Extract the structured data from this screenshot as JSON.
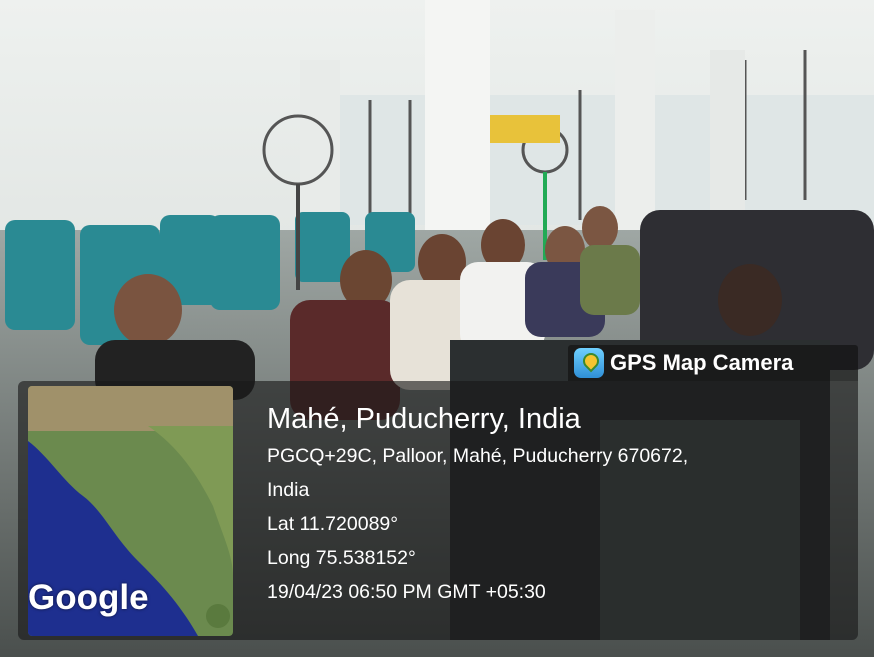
{
  "overlay": {
    "app_name": "GPS Map Camera",
    "location_title": "Mahé, Puducherry, India",
    "address_line1": "PGCQ+29C, Palloor, Mahé, Puducherry 670672,",
    "address_line2": "India",
    "latitude": "Lat 11.720089°",
    "longitude": "Long 75.538152°",
    "datetime": "19/04/23 06:50 PM GMT +05:30",
    "map_brand": "Google"
  },
  "icons": {
    "app_icon": "map-pin-icon"
  }
}
